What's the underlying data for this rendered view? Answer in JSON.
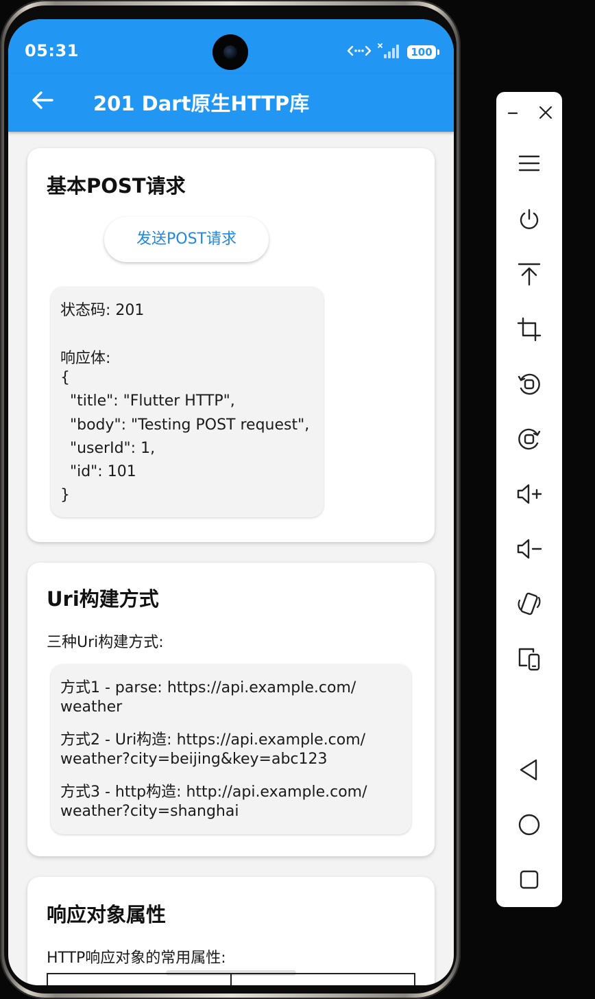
{
  "status_bar": {
    "time": "05:31",
    "battery": "100"
  },
  "app_bar": {
    "title": "201 Dart原生HTTP库",
    "back_icon": "arrow-back-icon"
  },
  "post_card": {
    "title": "基本POST请求",
    "button_label": "发送POST请求",
    "response_lines": [
      "状态码: 201",
      "",
      "响应体:",
      "{",
      "  \"title\": \"Flutter HTTP\",",
      "  \"body\": \"Testing POST request\",",
      "  \"userId\": 1,",
      "  \"id\": 101",
      "}"
    ]
  },
  "uri_card": {
    "title": "Uri构建方式",
    "description": "三种Uri构建方式:",
    "lines": [
      "方式1 - parse: https://api.example.com/",
      "weather",
      "方式2 - Uri构造: https://api.example.com/",
      "weather?city=beijing&key=abc123",
      "方式3 - http构造: http://api.example.com/",
      "weather?city=shanghai"
    ]
  },
  "response_card": {
    "title": "响应对象属性",
    "description": "HTTP响应对象的常用属性:"
  },
  "emulator_toolbar": {
    "items": [
      "minimize-icon",
      "close-icon",
      "menu-icon",
      "power-icon",
      "pin-top-icon",
      "crop-icon",
      "rotate-left-icon",
      "rotate-right-icon",
      "volume-up-icon",
      "volume-down-icon",
      "shake-icon",
      "multi-device-icon",
      "nav-back-icon",
      "nav-home-icon",
      "nav-recents-icon"
    ]
  },
  "colors": {
    "primary": "#2196f3",
    "button_text": "#1e88e5",
    "background": "#f3f3f3"
  }
}
